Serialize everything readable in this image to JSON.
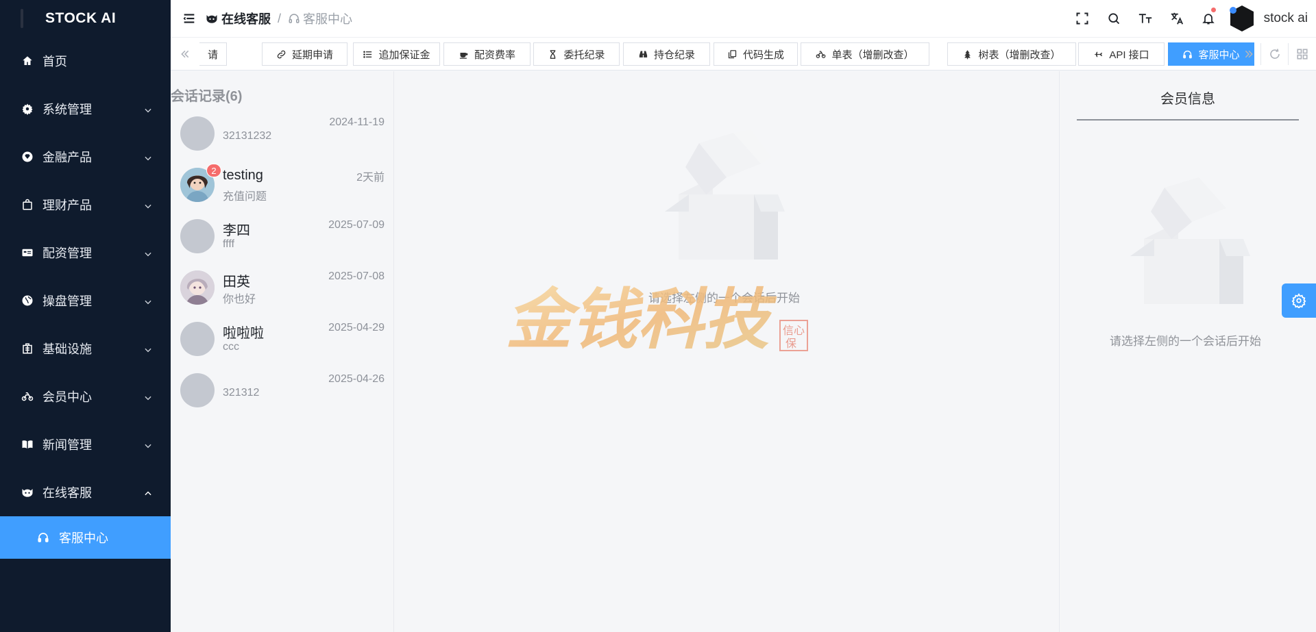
{
  "brand": {
    "name": "STOCK AI"
  },
  "sidebar": {
    "items": [
      {
        "label": "首页",
        "icon": "home-icon",
        "expandable": false
      },
      {
        "label": "系统管理",
        "icon": "gear-icon",
        "expandable": true
      },
      {
        "label": "金融产品",
        "icon": "diamond-icon",
        "expandable": true
      },
      {
        "label": "理财产品",
        "icon": "shopping-bag-icon",
        "expandable": true
      },
      {
        "label": "配资管理",
        "icon": "id-card-icon",
        "expandable": true
      },
      {
        "label": "操盘管理",
        "icon": "globe-icon",
        "expandable": true
      },
      {
        "label": "基础设施",
        "icon": "building-icon",
        "expandable": true
      },
      {
        "label": "会员中心",
        "icon": "bicycle-icon",
        "expandable": true
      },
      {
        "label": "新闻管理",
        "icon": "book-icon",
        "expandable": true
      },
      {
        "label": "在线客服",
        "icon": "github-cat-icon",
        "expandable": true,
        "expanded": true
      }
    ],
    "sub_active": {
      "label": "客服中心",
      "icon": "headset-icon"
    }
  },
  "header": {
    "breadcrumb": {
      "parent": "在线客服",
      "separator": "/",
      "current": "客服中心"
    },
    "icons": [
      "fullscreen-icon",
      "search-icon",
      "font-size-icon",
      "translate-icon",
      "bell-icon"
    ],
    "user": {
      "name": "stock ai"
    }
  },
  "tabs": [
    {
      "label": "请",
      "icon": ""
    },
    {
      "label": "延期申请",
      "icon": "link-icon"
    },
    {
      "label": "追加保证金",
      "icon": "list-icon"
    },
    {
      "label": "配资费率",
      "icon": "coffee-icon"
    },
    {
      "label": "委托纪录",
      "icon": "hourglass-icon"
    },
    {
      "label": "持仓纪录",
      "icon": "binoculars-icon"
    },
    {
      "label": "代码生成",
      "icon": "copy-icon"
    },
    {
      "label": "单表（增删改查）",
      "icon": "bicycle-icon"
    },
    {
      "label": "树表（增删改查）",
      "icon": "tree-icon"
    },
    {
      "label": "API 接口",
      "icon": "plane-icon"
    },
    {
      "label": "客服中心",
      "icon": "headset-icon",
      "active": true
    }
  ],
  "conversations": {
    "title": "会话记录(6)",
    "items": [
      {
        "name": "",
        "message": "32131232",
        "time": "2024-11-19",
        "avatar": "placeholder",
        "badge": ""
      },
      {
        "name": "testing",
        "message": "充值问题",
        "time": "2天前",
        "avatar": "photo-girl",
        "badge": "2"
      },
      {
        "name": "李四",
        "message": "ffff",
        "time": "2025-07-09",
        "avatar": "placeholder",
        "badge": ""
      },
      {
        "name": "田英",
        "message": "你也好",
        "time": "2025-07-08",
        "avatar": "photo-anime",
        "badge": ""
      },
      {
        "name": "啦啦啦",
        "message": "ccc",
        "time": "2025-04-29",
        "avatar": "placeholder",
        "badge": ""
      },
      {
        "name": "",
        "message": "321312",
        "time": "2025-04-26",
        "avatar": "placeholder",
        "badge": ""
      }
    ]
  },
  "chat": {
    "empty_text": "请选择左侧的一个会话后开始"
  },
  "member": {
    "title": "会员信息",
    "empty_text": "请选择左侧的一个会话后开始"
  },
  "watermark": {
    "text": "金钱科技",
    "seal": "信心保"
  },
  "colors": {
    "sidebar_bg": "#0f1b2d",
    "accent": "#409eff",
    "badge": "#f56c6c"
  }
}
